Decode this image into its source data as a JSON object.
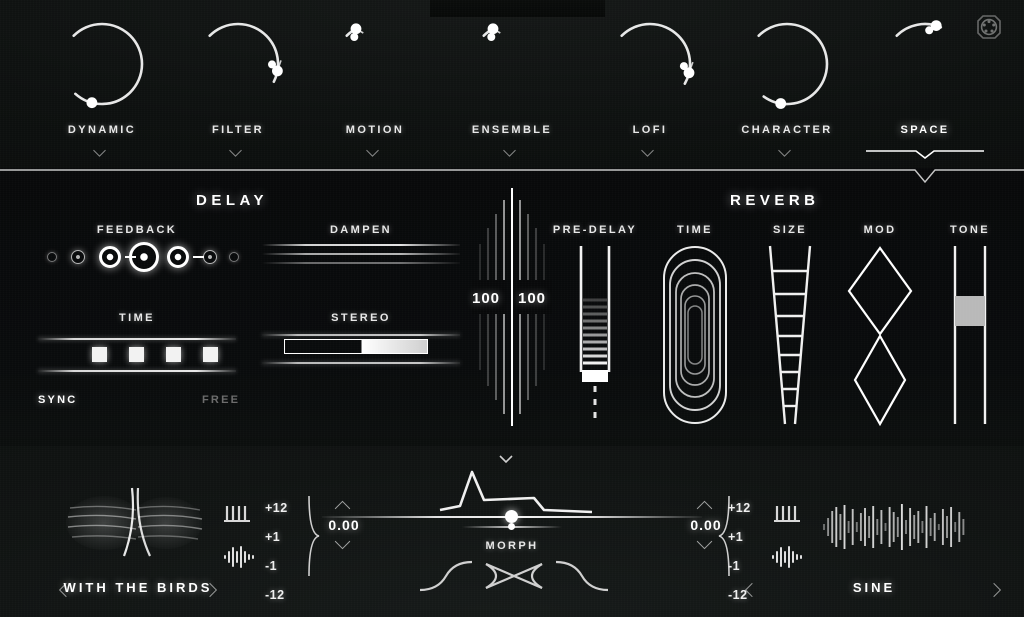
{
  "app": {
    "midi_icon": "midi-din-icon"
  },
  "topbar": {
    "tabs": [
      {
        "label": "DYNAMIC",
        "icon": "arc-knob-icon",
        "selected": false,
        "arc_value": 0.86,
        "dual": false
      },
      {
        "label": "FILTER",
        "icon": "arc-knob-icon",
        "selected": false,
        "arc_value": 0.52,
        "dual": true
      },
      {
        "label": "MOTION",
        "icon": "arc-knob-icon",
        "selected": false,
        "arc_value": 0.03,
        "dual": true
      },
      {
        "label": "ENSEMBLE",
        "icon": "arc-knob-icon",
        "selected": false,
        "arc_value": 0.03,
        "dual": true
      },
      {
        "label": "LOFI",
        "icon": "arc-knob-icon",
        "selected": false,
        "arc_value": 0.53,
        "dual": true
      },
      {
        "label": "CHARACTER",
        "icon": "arc-knob-icon",
        "selected": false,
        "arc_value": 0.84,
        "dual": false
      },
      {
        "label": "SPACE",
        "icon": "arc-knob-icon",
        "selected": true,
        "arc_value": 0.22,
        "dual": true
      }
    ],
    "chevron_icon": "chevron-down-icon",
    "selected_indicator_icon": "selected-tab-underline-icon"
  },
  "panel": {
    "delay": {
      "title": "DELAY",
      "feedback": {
        "label": "FEEDBACK",
        "dots": [
          {
            "size": 10,
            "ring": 1.4,
            "dot": 0,
            "opacity": 0.45
          },
          {
            "size": 14,
            "ring": 1.8,
            "dot": 3.5,
            "opacity": 0.7
          },
          {
            "size": 22,
            "ring": 3.2,
            "dot": 6,
            "opacity": 1.0
          },
          {
            "size": 30,
            "ring": 3.6,
            "dot": 7,
            "opacity": 1.0
          },
          {
            "size": 22,
            "ring": 3.2,
            "dot": 6,
            "opacity": 1.0
          },
          {
            "size": 14,
            "ring": 1.8,
            "dot": 3.5,
            "opacity": 0.7
          },
          {
            "size": 10,
            "ring": 1.4,
            "dot": 0,
            "opacity": 0.45
          }
        ]
      },
      "time": {
        "label": "TIME",
        "steps": 4
      },
      "mode": {
        "sync_label": "SYNC",
        "free_label": "FREE",
        "active": "SYNC"
      },
      "dampen": {
        "label": "DAMPEN"
      },
      "stereo": {
        "label": "STEREO",
        "value": 54
      }
    },
    "mix": {
      "left_value": "100",
      "right_value": "100"
    },
    "reverb": {
      "title": "REVERB",
      "controls": [
        {
          "label": "PRE-DELAY",
          "icon": "ladder-slider-icon"
        },
        {
          "label": "TIME",
          "icon": "concentric-rings-icon"
        },
        {
          "label": "SIZE",
          "icon": "tapered-ladder-icon"
        },
        {
          "label": "MOD",
          "icon": "double-diamond-icon"
        },
        {
          "label": "TONE",
          "icon": "vertical-fader-icon"
        }
      ]
    }
  },
  "bottom": {
    "left_source": {
      "name": "WITH THE BIRDS",
      "prev_icon": "chevron-left-icon",
      "next_icon": "chevron-right-icon",
      "thumbnail_icon": "waveform-thumbnail-icon",
      "keys_icon": "keyboard-icon",
      "wave_icon": "waveform-icon",
      "pitch_marks": [
        "+12",
        "+1",
        "-1",
        "-12"
      ],
      "tune_value": "0.00",
      "up_icon": "chevron-up-icon",
      "down_icon": "chevron-down-icon"
    },
    "morph": {
      "label": "MORPH",
      "envelope_icon": "envelope-curve-icon",
      "crossfade_icon": "crossfade-x-icon",
      "position": 50
    },
    "right_source": {
      "name": "SINE",
      "prev_icon": "chevron-left-icon",
      "next_icon": "chevron-right-icon",
      "thumbnail_icon": "waveform-bars-icon",
      "keys_icon": "keyboard-icon",
      "wave_icon": "waveform-icon",
      "pitch_marks": [
        "+12",
        "+1",
        "-1",
        "-12"
      ],
      "tune_value": "0.00",
      "up_icon": "chevron-up-icon",
      "down_icon": "chevron-down-icon"
    }
  },
  "colors": {
    "background": "#0c0e0d",
    "panel": "#08090a",
    "accent": "#ffffff",
    "dim": "#6b6b6b"
  }
}
